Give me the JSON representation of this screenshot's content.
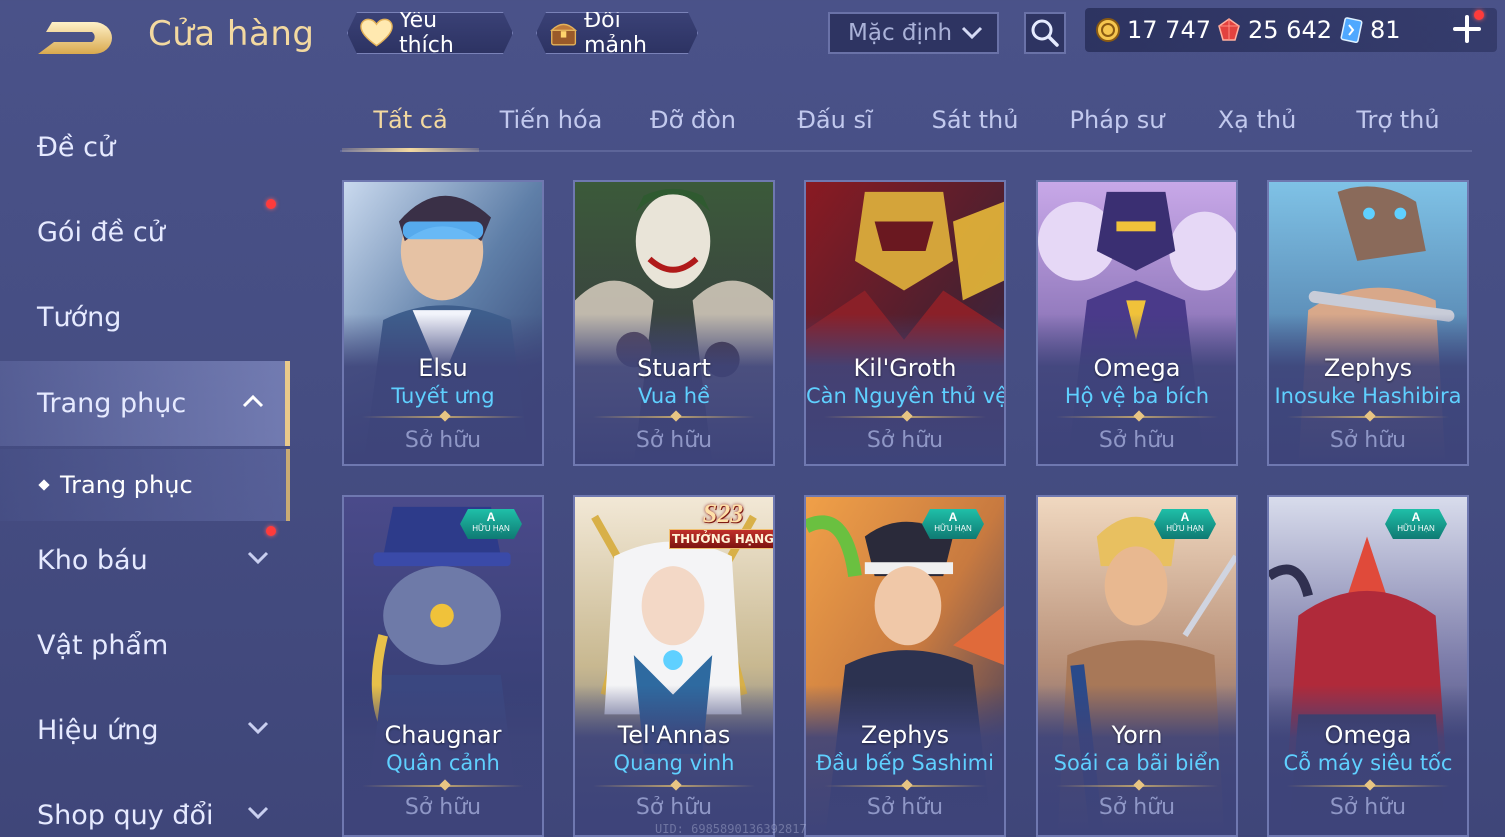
{
  "header": {
    "title": "Cửa hàng",
    "favorites_label": "Yêu thích",
    "exchange_label": "Đổi mảnh",
    "sort_value": "Mặc định",
    "currencies": [
      {
        "name": "gold",
        "value": "17 747"
      },
      {
        "name": "ruby",
        "value": "25 642"
      },
      {
        "name": "voucher",
        "value": "81"
      }
    ]
  },
  "sidebar": {
    "items": [
      {
        "label": "Đề cử"
      },
      {
        "label": "Gói đề cử"
      },
      {
        "label": "Tướng"
      },
      {
        "label": "Trang phục"
      },
      {
        "label": "Trang phục"
      },
      {
        "label": "Kho báu"
      },
      {
        "label": "Vật phẩm"
      },
      {
        "label": "Hiệu ứng"
      },
      {
        "label": "Shop quy đổi"
      }
    ]
  },
  "tabs": [
    "Tất cả",
    "Tiến hóa",
    "Đỡ đòn",
    "Đấu sĩ",
    "Sát thủ",
    "Pháp sư",
    "Xạ thủ",
    "Trợ thủ"
  ],
  "cards": [
    {
      "hero": "Elsu",
      "skin": "Tuyết ưng",
      "status": "Sở hữu"
    },
    {
      "hero": "Stuart",
      "skin": "Vua hề",
      "status": "Sở hữu"
    },
    {
      "hero": "Kil'Groth",
      "skin": "Càn Nguyên thủ vệ",
      "status": "Sở hữu"
    },
    {
      "hero": "Omega",
      "skin": "Hộ vệ ba bích",
      "status": "Sở hữu"
    },
    {
      "hero": "Zephys",
      "skin": "Inosuke Hashibira",
      "status": "Sở hữu"
    },
    {
      "hero": "Chaugnar",
      "skin": "Quân cảnh",
      "status": "Sở hữu",
      "badge_grade": "A",
      "badge_text": "HỮU HẠN"
    },
    {
      "hero": "Tel'Annas",
      "skin": "Quang vinh",
      "status": "Sở hữu",
      "season": "S23",
      "season_text": "THƯỞNG HẠNG"
    },
    {
      "hero": "Zephys",
      "skin": "Đầu bếp Sashimi",
      "status": "Sở hữu",
      "badge_grade": "A",
      "badge_text": "HỮU HẠN"
    },
    {
      "hero": "Yorn",
      "skin": "Soái ca bãi biển",
      "status": "Sở hữu",
      "badge_grade": "A",
      "badge_text": "HỮU HẠN"
    },
    {
      "hero": "Omega",
      "skin": "Cỗ máy siêu tốc",
      "status": "Sở hữu",
      "badge_grade": "A",
      "badge_text": "HỮU HẠN"
    }
  ],
  "footer": {
    "uid": "UID: 6985890136392817"
  },
  "colors": {
    "accent": "#f3d9a0",
    "skin_name": "#5fd0ff",
    "background": "#464e84",
    "notification": "#ff3b3b"
  }
}
